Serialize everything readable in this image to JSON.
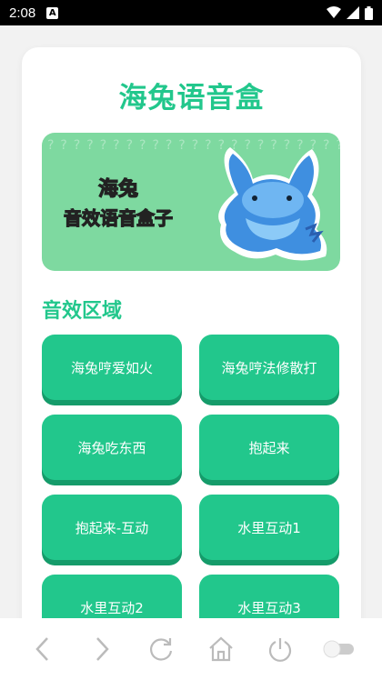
{
  "status": {
    "time": "2:08",
    "notif_letter": "A"
  },
  "app": {
    "title": "海兔语音盒"
  },
  "banner": {
    "line1": "海兔",
    "line2": "音效语音盒子",
    "pattern": "??????????????????????????????????????????????????????????????????????????????????????????????????????????????????????????????????????????????????????????????"
  },
  "section": {
    "title": "音效区域"
  },
  "buttons": [
    {
      "label": "海兔哼爱如火"
    },
    {
      "label": "海兔哼法修散打"
    },
    {
      "label": "海兔吃东西"
    },
    {
      "label": "抱起来"
    },
    {
      "label": "抱起来-互动"
    },
    {
      "label": "水里互动1"
    },
    {
      "label": "水里互动2"
    },
    {
      "label": "水里互动3"
    }
  ],
  "colors": {
    "accent": "#22c78c",
    "accent_shadow": "#159b6a",
    "banner_bg": "#7ed9a0"
  },
  "icons": [
    "back-icon",
    "forward-icon",
    "reload-icon",
    "home-icon",
    "power-icon",
    "toggle-icon"
  ]
}
